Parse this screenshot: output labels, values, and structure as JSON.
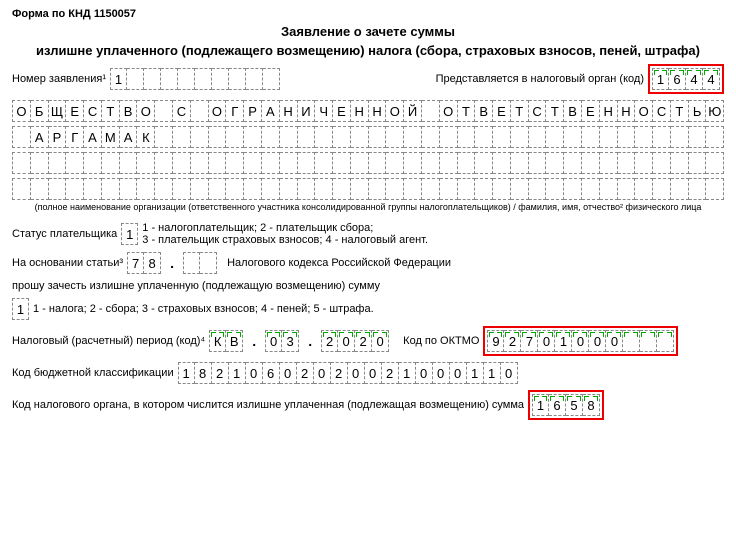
{
  "form_code_label": "Форма по КНД 1150057",
  "title_line1": "Заявление о зачете суммы",
  "title_line2": "излишне уплаченного (подлежащего возмещению) налога (сбора, страховых взносов, пеней, штрафа)",
  "app_number_label": "Номер заявления¹",
  "app_number_cells": [
    "1",
    "",
    "",
    "",
    "",
    "",
    "",
    "",
    "",
    ""
  ],
  "presented_label": "Представляется в налоговый орган (код)",
  "tax_office_cells": [
    "1",
    "6",
    "4",
    "4"
  ],
  "org_name_rows": [
    [
      "О",
      "Б",
      "Щ",
      "Е",
      "С",
      "Т",
      "В",
      "О",
      "",
      "С",
      "",
      "О",
      "Г",
      "Р",
      "А",
      "Н",
      "И",
      "Ч",
      "Е",
      "Н",
      "Н",
      "О",
      "Й",
      "",
      "О",
      "Т",
      "В",
      "Е",
      "Т",
      "С",
      "Т",
      "В",
      "Е",
      "Н",
      "Н",
      "О",
      "С",
      "Т",
      "Ь",
      "Ю"
    ],
    [
      "",
      "А",
      "Р",
      "Г",
      "А",
      "М",
      "А",
      "К",
      "",
      "",
      "",
      "",
      "",
      "",
      "",
      "",
      "",
      "",
      "",
      "",
      "",
      "",
      "",
      "",
      "",
      "",
      "",
      "",
      "",
      "",
      "",
      "",
      "",
      "",
      "",
      "",
      "",
      "",
      "",
      ""
    ],
    [
      "",
      "",
      "",
      "",
      "",
      "",
      "",
      "",
      "",
      "",
      "",
      "",
      "",
      "",
      "",
      "",
      "",
      "",
      "",
      "",
      "",
      "",
      "",
      "",
      "",
      "",
      "",
      "",
      "",
      "",
      "",
      "",
      "",
      "",
      "",
      "",
      "",
      "",
      "",
      ""
    ],
    [
      "",
      "",
      "",
      "",
      "",
      "",
      "",
      "",
      "",
      "",
      "",
      "",
      "",
      "",
      "",
      "",
      "",
      "",
      "",
      "",
      "",
      "",
      "",
      "",
      "",
      "",
      "",
      "",
      "",
      "",
      "",
      "",
      "",
      "",
      "",
      "",
      "",
      "",
      "",
      ""
    ]
  ],
  "org_caption": "(полное наименование организации (ответственного участника консолидированной группы налогоплательщиков) / фамилия, имя, отчество² физического лица",
  "payer_status_label": "Статус плательщика",
  "payer_status_cells": [
    "1"
  ],
  "payer_status_legend1": "1 - налогоплательщик; 2 - плательщик сбора;",
  "payer_status_legend2": "3 - плательщик страховых взносов; 4 - налоговый агент.",
  "article_label": "На основании статьи³",
  "article_cells1": [
    "7",
    "8"
  ],
  "article_cells2": [
    "",
    ""
  ],
  "article_tail": "Налогового кодекса Российской Федерации",
  "ask_line": "прошу зачесть излишне уплаченную (подлежащую возмещению) сумму",
  "sum_type_cells": [
    "1"
  ],
  "sum_type_legend": "1 - налога; 2 - сбора; 3 - страховых взносов; 4 - пеней; 5 - штрафа.",
  "period_label": "Налоговый (расчетный) период (код)⁴",
  "period_cells1": [
    "К",
    "В"
  ],
  "period_cells2": [
    "0",
    "3"
  ],
  "period_cells3": [
    "2",
    "0",
    "2",
    "0"
  ],
  "oktmo_label": "Код по ОКТМО",
  "oktmo_cells": [
    "9",
    "2",
    "7",
    "0",
    "1",
    "0",
    "0",
    "0",
    "",
    "",
    ""
  ],
  "kbk_label": "Код бюджетной классификации",
  "kbk_cells": [
    "1",
    "8",
    "2",
    "1",
    "0",
    "6",
    "0",
    "2",
    "0",
    "2",
    "0",
    "0",
    "2",
    "1",
    "0",
    "0",
    "0",
    "1",
    "1",
    "0"
  ],
  "office2_label": "Код налогового органа, в котором числится излишне уплаченная (подлежащая возмещению) сумма",
  "office2_cells": [
    "1",
    "6",
    "5",
    "8"
  ]
}
